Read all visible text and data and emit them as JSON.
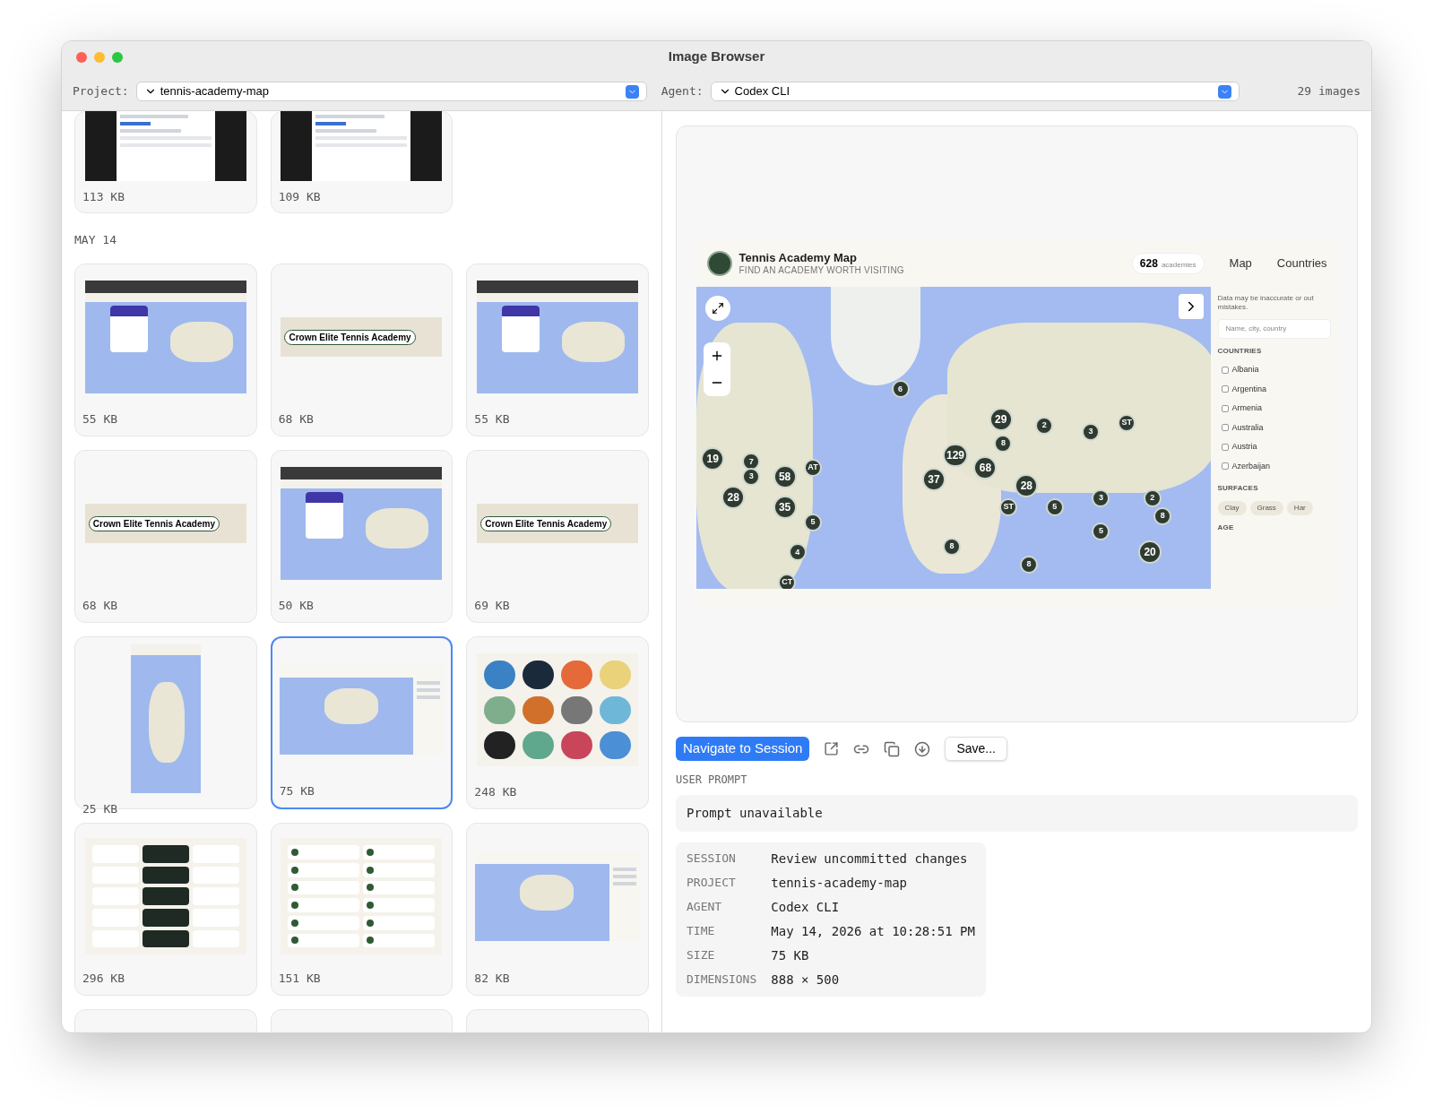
{
  "window": {
    "title": "Image Browser"
  },
  "toolbar": {
    "project_label": "Project:",
    "project": "tennis-academy-map",
    "agent_label": "Agent:",
    "agent": "Codex CLI",
    "count": "29 images"
  },
  "groups": [
    {
      "images": [
        {
          "kind": "document",
          "size": "113 KB",
          "selected": false
        },
        {
          "kind": "document",
          "size": "109 KB",
          "selected": false
        }
      ]
    },
    {
      "date": "MAY 14",
      "images": [
        {
          "kind": "map",
          "size": "55 KB",
          "selected": false
        },
        {
          "kind": "banner",
          "caption": "Crown Elite Tennis Academy",
          "size": "68 KB",
          "selected": false
        },
        {
          "kind": "map",
          "size": "55 KB",
          "selected": false
        },
        {
          "kind": "banner",
          "caption": "Crown Elite Tennis Academy",
          "size": "68 KB",
          "selected": false
        },
        {
          "kind": "map",
          "size": "50 KB",
          "selected": false
        },
        {
          "kind": "banner",
          "caption": "Crown Elite Tennis Academy",
          "size": "69 KB",
          "selected": false
        },
        {
          "kind": "phone",
          "size": "25 KB",
          "selected": false
        },
        {
          "kind": "wide",
          "size": "75 KB",
          "selected": true
        },
        {
          "kind": "icons",
          "size": "248 KB",
          "selected": false
        },
        {
          "kind": "sheet",
          "size": "296 KB",
          "selected": false
        },
        {
          "kind": "list",
          "size": "151 KB",
          "selected": false
        },
        {
          "kind": "wide",
          "size": "82 KB",
          "selected": false
        }
      ]
    }
  ],
  "preview": {
    "app_title": "Tennis Academy Map",
    "app_subtitle": "FIND AN ACADEMY WORTH VISITING",
    "count": "628",
    "count_label": "academies",
    "nav": [
      "Map",
      "Countries"
    ],
    "markers": [
      {
        "label": "6"
      },
      {
        "label": "29"
      },
      {
        "label": "2"
      },
      {
        "label": "3"
      },
      {
        "label": "ST"
      },
      {
        "label": "8"
      },
      {
        "label": "129"
      },
      {
        "label": "68"
      },
      {
        "label": "37"
      },
      {
        "label": "28"
      },
      {
        "label": "ST"
      },
      {
        "label": "5"
      },
      {
        "label": "3"
      },
      {
        "label": "2"
      },
      {
        "label": "8"
      },
      {
        "label": "5"
      },
      {
        "label": "20"
      },
      {
        "label": "8"
      },
      {
        "label": "8"
      },
      {
        "label": "19"
      },
      {
        "label": "7"
      },
      {
        "label": "3"
      },
      {
        "label": "58"
      },
      {
        "label": "AT"
      },
      {
        "label": "28"
      },
      {
        "label": "35"
      },
      {
        "label": "5"
      },
      {
        "label": "4"
      },
      {
        "label": "CT"
      }
    ],
    "disclaimer": "Data may be inaccurate or out mistakes.",
    "search_placeholder": "Name, city, country",
    "countries_heading": "COUNTRIES",
    "countries": [
      {
        "name": "Albania",
        "checked": false
      },
      {
        "name": "Argentina",
        "checked": false
      },
      {
        "name": "Armenia",
        "checked": false
      },
      {
        "name": "Australia",
        "checked": false
      },
      {
        "name": "Austria",
        "checked": false
      },
      {
        "name": "Azerbaijan",
        "checked": false
      }
    ],
    "surfaces_heading": "SURFACES",
    "surfaces": [
      "Clay",
      "Grass",
      "Har"
    ],
    "age_heading": "AGE"
  },
  "actions": {
    "primary": "Navigate to Session",
    "save": "Save..."
  },
  "prompt": {
    "heading": "USER PROMPT",
    "text": "Prompt unavailable"
  },
  "details": [
    {
      "label": "SESSION",
      "value": "Review uncommitted changes"
    },
    {
      "label": "PROJECT",
      "value": "tennis-academy-map"
    },
    {
      "label": "AGENT",
      "value": "Codex CLI"
    },
    {
      "label": "TIME",
      "value": "May 14, 2026 at 10:28:51 PM"
    },
    {
      "label": "SIZE",
      "value": "75 KB"
    },
    {
      "label": "DIMENSIONS",
      "value": "888 × 500"
    }
  ]
}
